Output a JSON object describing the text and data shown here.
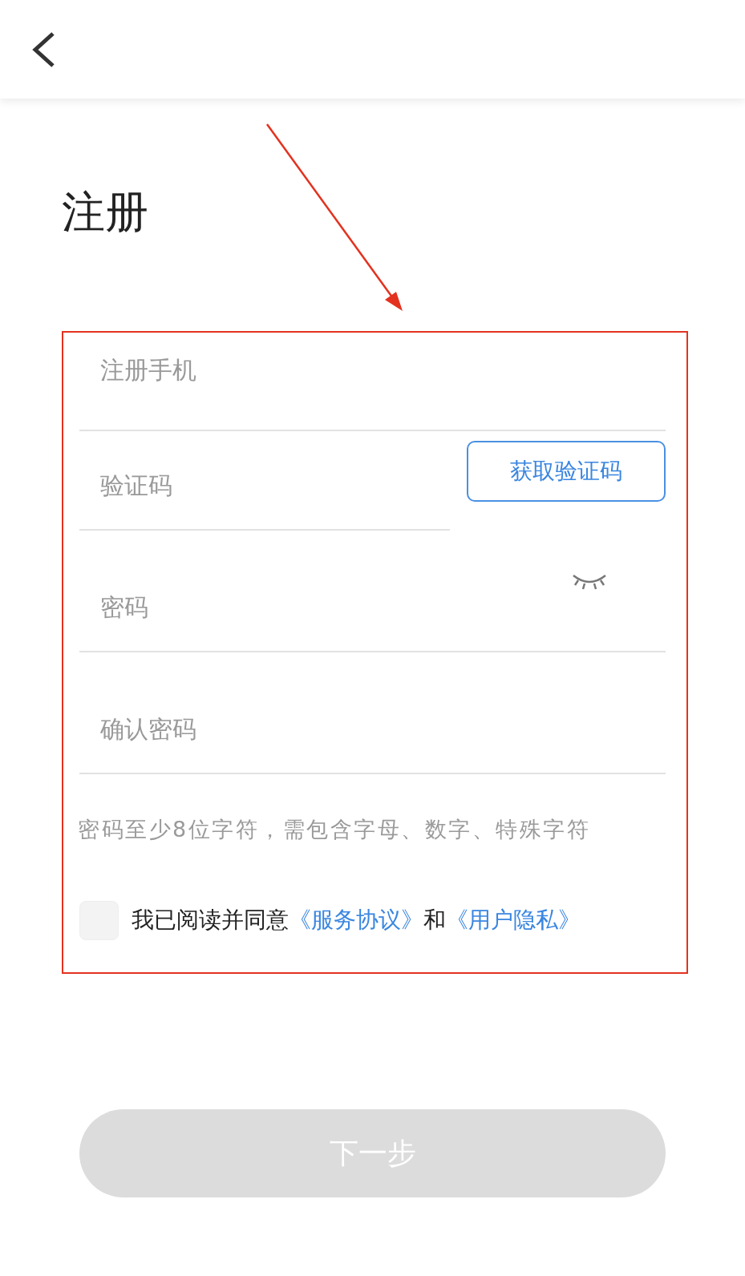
{
  "title": "注册",
  "fields": [
    {
      "kind": "text",
      "placeholder": "注册手机"
    },
    {
      "kind": "code",
      "placeholder": "验证码",
      "button": "获取验证码"
    },
    {
      "kind": "password",
      "placeholder": "密码",
      "visible": false
    },
    {
      "kind": "text",
      "placeholder": "确认密码"
    }
  ],
  "hint": "密码至少8位字符，需包含字母、数字、特殊字符",
  "agreement": {
    "checked": false,
    "text": "我已阅读并同意",
    "link1": "《服务协议》",
    "joiner": "和",
    "link2": "《用户隐私》"
  },
  "next_button": {
    "label": "下一步",
    "disabled": true
  }
}
